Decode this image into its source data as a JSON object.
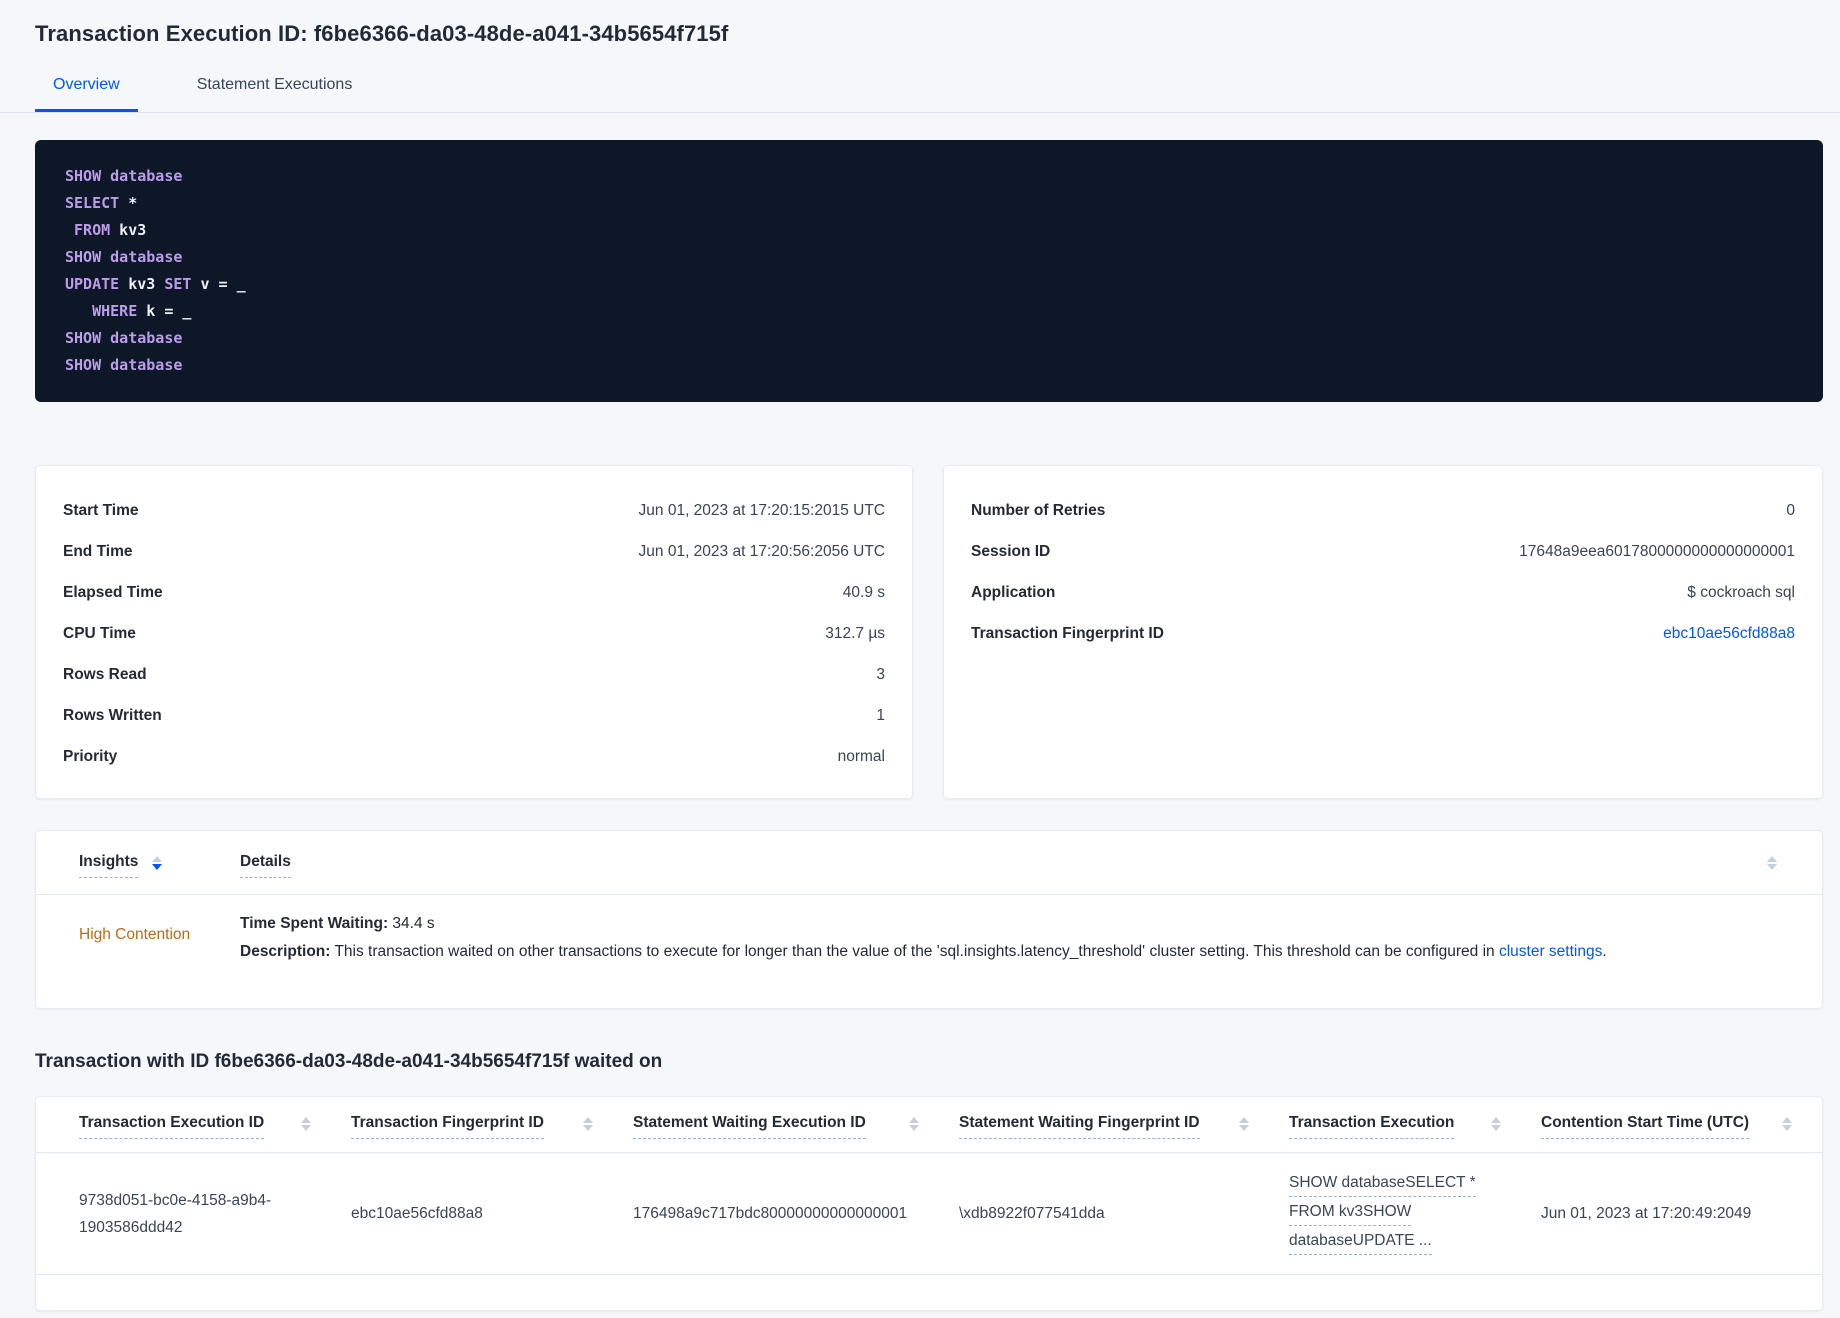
{
  "header": {
    "title": "Transaction Execution ID: f6be6366-da03-48de-a041-34b5654f715f",
    "tabs": [
      {
        "label": "Overview",
        "active": true
      },
      {
        "label": "Statement Executions",
        "active": false
      }
    ]
  },
  "sql": {
    "lines": [
      [
        {
          "t": "SHOW database",
          "c": "k"
        }
      ],
      [
        {
          "t": "SELECT",
          "c": "k"
        },
        {
          "t": " *",
          "c": "p"
        }
      ],
      [
        {
          "t": " ",
          "c": "p"
        },
        {
          "t": "FROM",
          "c": "k"
        },
        {
          "t": " kv3",
          "c": "p"
        }
      ],
      [
        {
          "t": "SHOW database",
          "c": "k"
        }
      ],
      [
        {
          "t": "UPDATE",
          "c": "k"
        },
        {
          "t": " kv3 ",
          "c": "p"
        },
        {
          "t": "SET",
          "c": "k"
        },
        {
          "t": " v = _",
          "c": "p"
        }
      ],
      [
        {
          "t": "   ",
          "c": "p"
        },
        {
          "t": "WHERE",
          "c": "k"
        },
        {
          "t": " k = _",
          "c": "p"
        }
      ],
      [
        {
          "t": "SHOW database",
          "c": "k"
        }
      ],
      [
        {
          "t": "SHOW database",
          "c": "k"
        }
      ]
    ]
  },
  "summary": {
    "left": {
      "rows": [
        {
          "label": "Start Time",
          "value": "Jun 01, 2023 at 17:20:15:2015 UTC"
        },
        {
          "label": "End Time",
          "value": "Jun 01, 2023 at 17:20:56:2056 UTC"
        },
        {
          "label": "Elapsed Time",
          "value": "40.9 s"
        },
        {
          "label": "CPU Time",
          "value": "312.7 µs"
        },
        {
          "label": "Rows Read",
          "value": "3"
        },
        {
          "label": "Rows Written",
          "value": "1"
        },
        {
          "label": "Priority",
          "value": "normal"
        }
      ]
    },
    "right": {
      "rows": [
        {
          "label": "Number of Retries",
          "value": "0"
        },
        {
          "label": "Session ID",
          "value": "17648a9eea6017800000000000000001"
        },
        {
          "label": "Application",
          "value": "$ cockroach sql"
        },
        {
          "label": "Transaction Fingerprint ID",
          "value": "ebc10ae56cfd88a8"
        }
      ]
    }
  },
  "insights": {
    "col_insights": "Insights",
    "col_details": "Details",
    "row": {
      "insight": "High Contention",
      "waiting_label": "Time Spent Waiting:",
      "waiting_value": " 34.4 s",
      "desc_label": "Description:",
      "desc_text": " This transaction waited on other transactions to execute for longer than the value of the 'sql.insights.latency_threshold' cluster setting. This threshold can be configured in ",
      "desc_link": "cluster settings",
      "desc_end": "."
    }
  },
  "waited": {
    "heading": "Transaction with ID f6be6366-da03-48de-a041-34b5654f715f waited on",
    "columns": [
      "Transaction Execution ID",
      "Transaction Fingerprint ID",
      "Statement Waiting Execution ID",
      "Statement Waiting Fingerprint ID",
      "Transaction Execution",
      "Contention Start Time (UTC)"
    ],
    "row": {
      "txn_execution_id": "9738d051-bc0e-4158-a9b4-1903586ddd42",
      "txn_fingerprint_id": "ebc10ae56cfd88a8",
      "stmt_waiting_execution_id": "176498a9c717bdc80000000000000001",
      "stmt_waiting_fingerprint_id": "\\xdb8922f077541dda",
      "txn_execution_lines": [
        "SHOW databaseSELECT *",
        "FROM kv3SHOW",
        "databaseUPDATE ..."
      ],
      "contention_start": "Jun 01, 2023 at 17:20:49:2049"
    }
  },
  "colors": {
    "accent_blue": "#0055ff",
    "insight_warning_text": "#c4680f",
    "code_background": "#0d1727",
    "code_keyword": "#bd9ceb",
    "page_background": "#f5f7fa"
  }
}
